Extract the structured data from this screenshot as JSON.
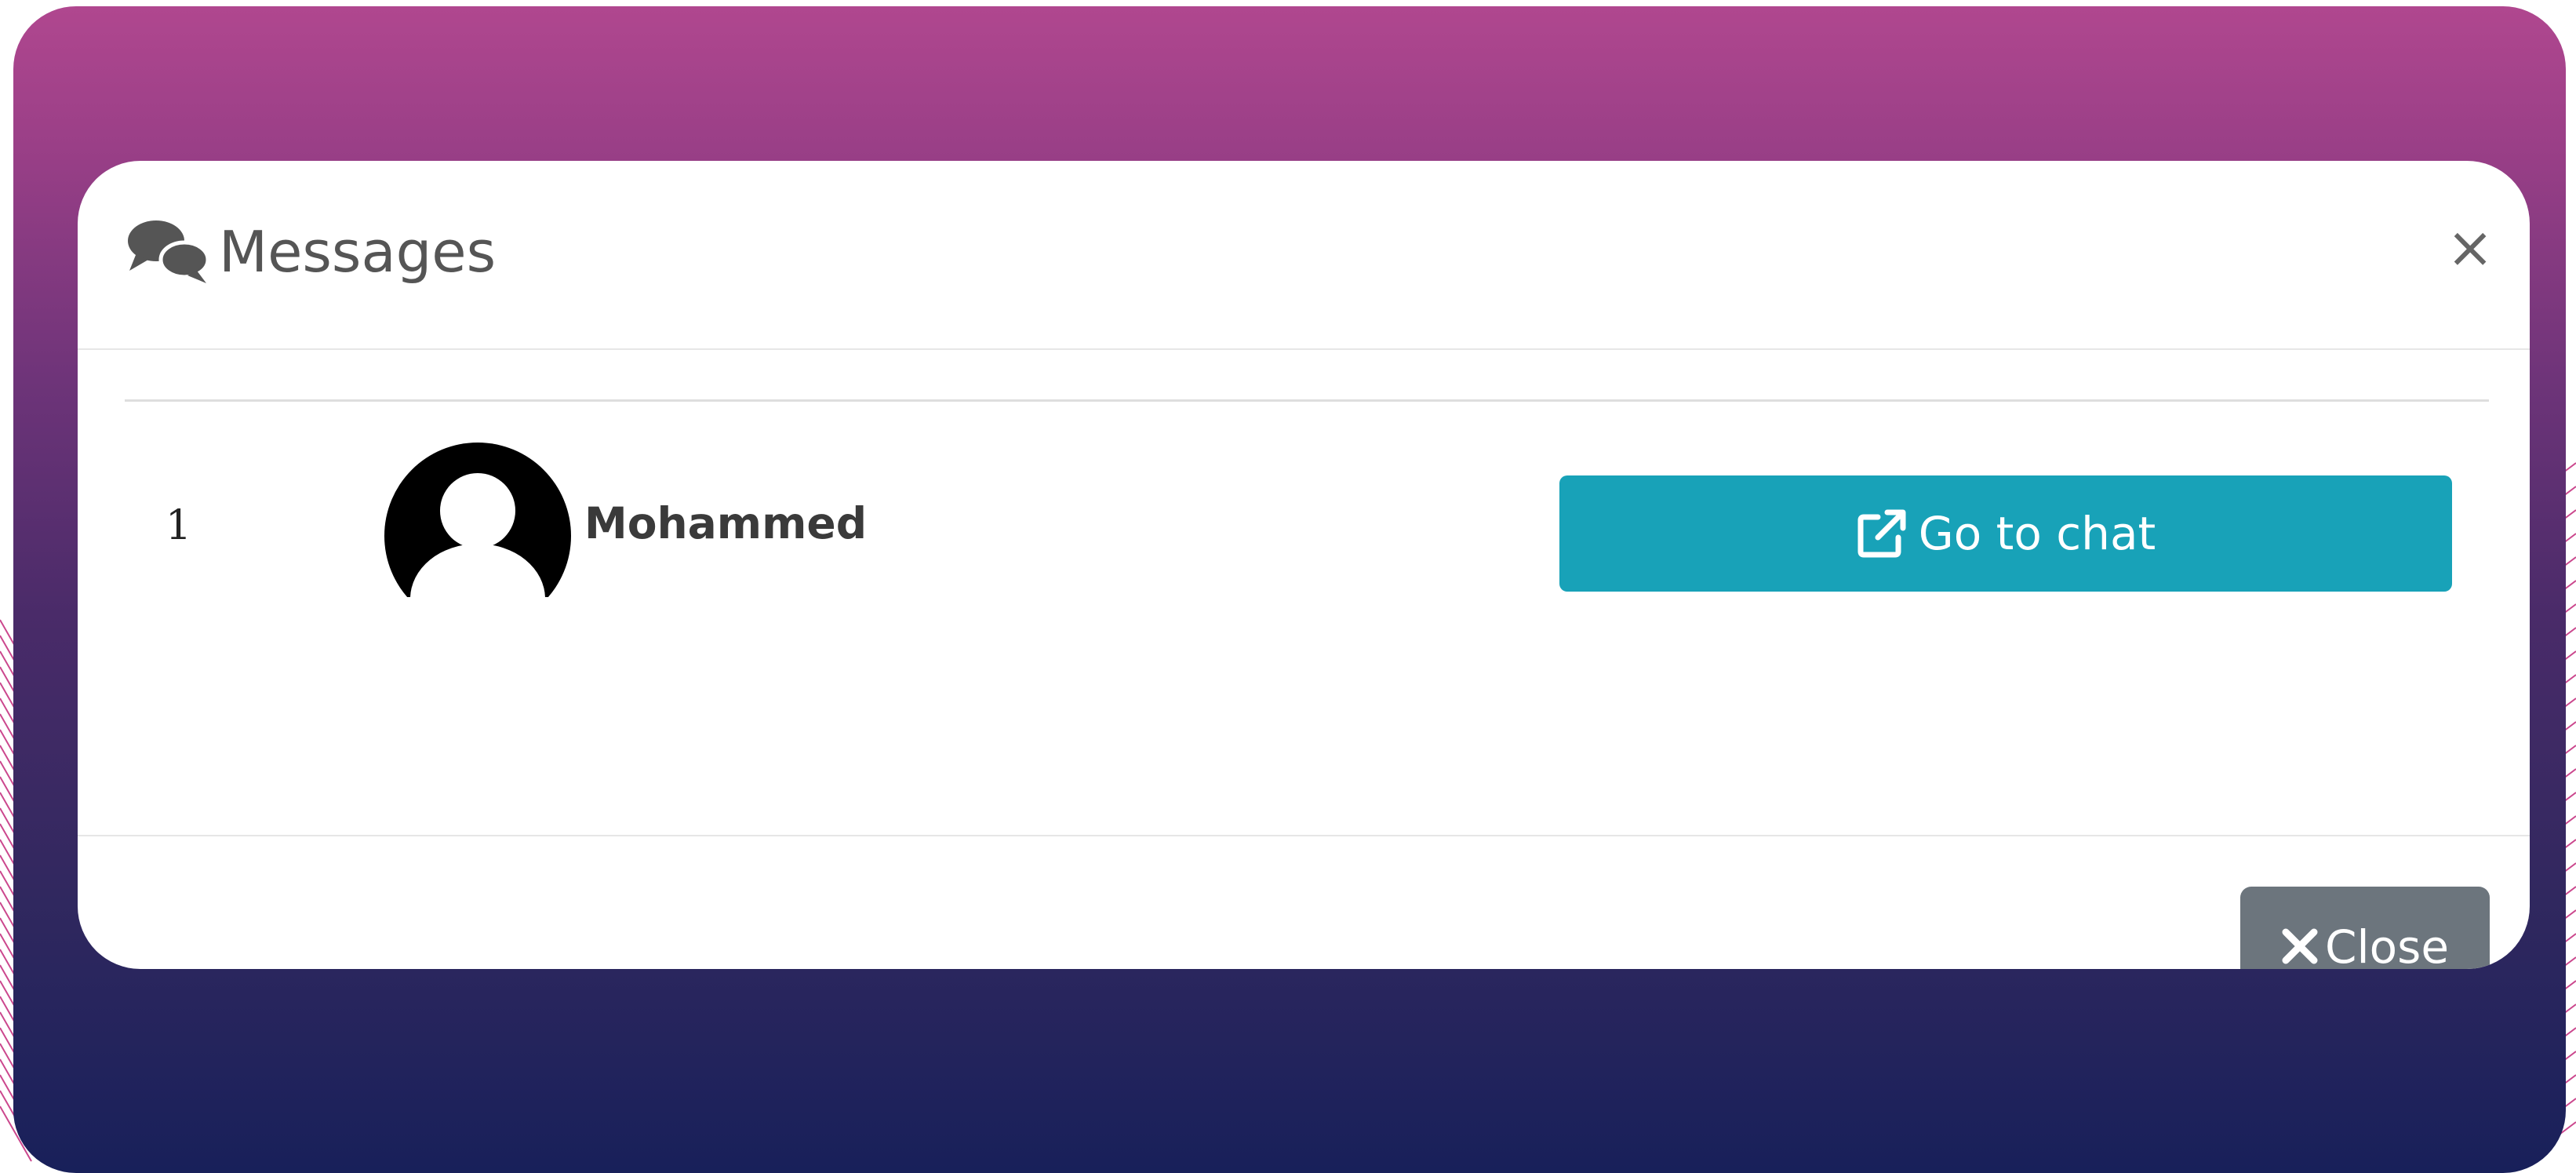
{
  "modal": {
    "title": "Messages",
    "title_icon": "comments-icon",
    "close_icon": "close-icon",
    "close_glyph": "×"
  },
  "messages": [
    {
      "index": "1",
      "avatar_icon": "default-user-avatar-icon",
      "name": "Mohammed",
      "action_label": "Go to chat",
      "action_icon": "external-link-icon"
    }
  ],
  "footer": {
    "close_label": "Close",
    "close_icon": "times-icon"
  },
  "colors": {
    "gradient_top": "#b0478f",
    "gradient_bottom": "#18205a",
    "primary_button": "#18a2b8",
    "secondary_button": "#6c757d",
    "title_text": "#555555"
  }
}
